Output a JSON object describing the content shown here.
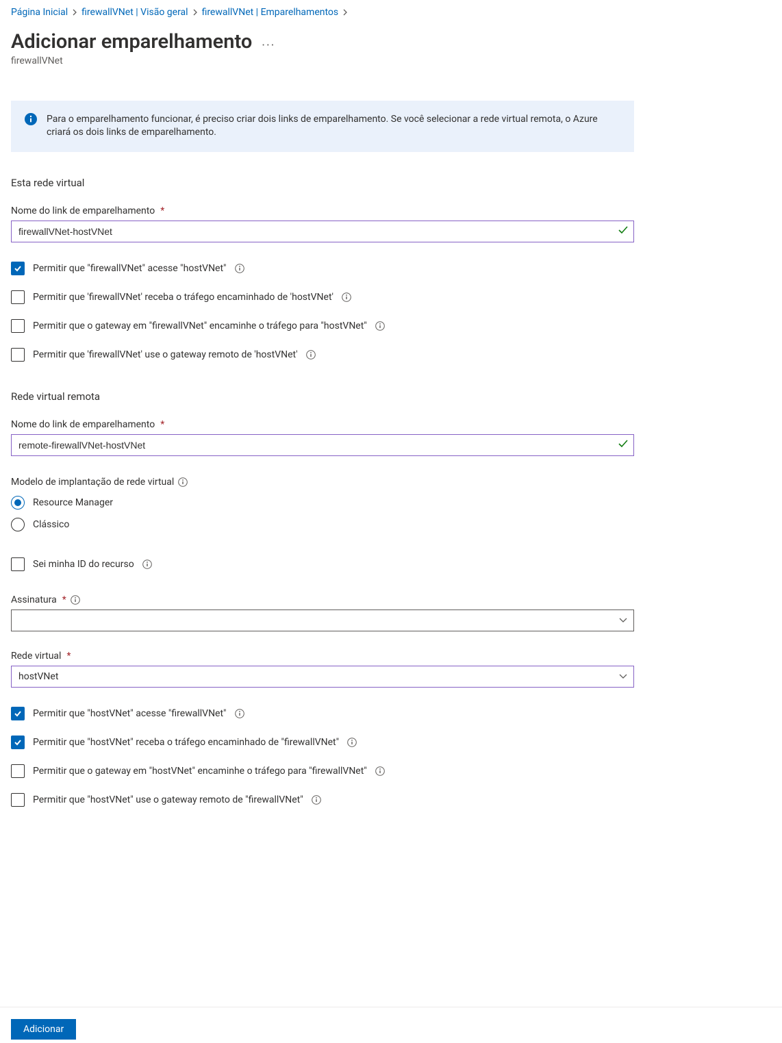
{
  "breadcrumb": {
    "items": [
      {
        "label": "Página Inicial"
      },
      {
        "label": "firewallVNet | Visão geral"
      },
      {
        "label": "firewallVNet | Emparelhamentos"
      }
    ]
  },
  "header": {
    "title": "Adicionar emparelhamento",
    "subtitle": "firewallVNet"
  },
  "info_banner": {
    "message": "Para o emparelhamento funcionar, é preciso criar dois links de emparelhamento. Se você selecionar a rede virtual remota, o Azure criará os dois links de emparelhamento."
  },
  "this_vnet": {
    "heading": "Esta rede virtual",
    "link_name_label": "Nome do link de emparelhamento",
    "link_name_value": "firewallVNet-hostVNet",
    "opts": [
      {
        "label": "Permitir que \"firewallVNet\" acesse \"hostVNet\"",
        "checked": true
      },
      {
        "label": "Permitir que 'firewallVNet' receba o tráfego encaminhado de 'hostVNet'",
        "checked": false
      },
      {
        "label": "Permitir que o gateway em \"firewallVNet\" encaminhe o tráfego para \"hostVNet\"",
        "checked": false
      },
      {
        "label": "Permitir que 'firewallVNet' use o gateway remoto de 'hostVNet'",
        "checked": false
      }
    ]
  },
  "remote_vnet": {
    "heading": "Rede virtual remota",
    "link_name_label": "Nome do link de emparelhamento",
    "link_name_value": "remote-firewallVNet-hostVNet",
    "deployment_model_label": "Modelo de implantação de rede virtual",
    "deployment_model": {
      "options": [
        {
          "label": "Resource Manager",
          "selected": true
        },
        {
          "label": "Clássico",
          "selected": false
        }
      ]
    },
    "know_resource_id": {
      "label": "Sei minha ID do recurso",
      "checked": false
    },
    "subscription_label": "Assinatura",
    "subscription_value": "",
    "vnet_label": "Rede virtual",
    "vnet_value": "hostVNet",
    "opts": [
      {
        "label": "Permitir que \"hostVNet\" acesse \"firewallVNet\"",
        "checked": true
      },
      {
        "label": "Permitir que \"hostVNet\" receba o tráfego encaminhado de \"firewallVNet\"",
        "checked": true
      },
      {
        "label": "Permitir que o gateway em \"hostVNet\" encaminhe o tráfego para \"firewallVNet\"",
        "checked": false
      },
      {
        "label": "Permitir que \"hostVNet\" use o gateway remoto de \"firewallVNet\"",
        "checked": false
      }
    ]
  },
  "footer": {
    "add_label": "Adicionar"
  }
}
